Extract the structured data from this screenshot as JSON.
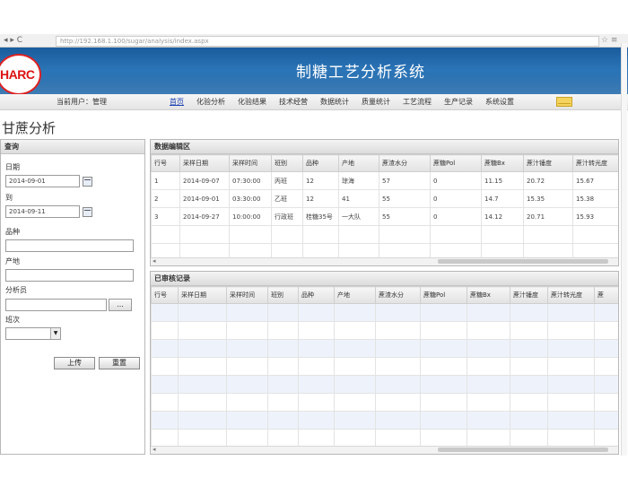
{
  "browser": {
    "nav": "◂ ▸ C",
    "address": "http://192.168.1.100/sugar/analysis/index.aspx",
    "star": "☆ ≡"
  },
  "header": {
    "logo_text": "HARC",
    "system_title": "制糖工艺分析系统"
  },
  "menubar": {
    "current_user": "当前用户：管理",
    "items": [
      "首页",
      "化验分析",
      "化验结果",
      "技术经营",
      "数据统计",
      "质量统计",
      "工艺流程",
      "生产记录",
      "系统设置"
    ],
    "active_index": 0
  },
  "page": {
    "title": "甘蔗分析"
  },
  "query": {
    "header": "查询",
    "date_label": "日期",
    "date_from": "2014-09-01",
    "to_label": "到",
    "date_to": "2014-09-11",
    "variety_label": "品种",
    "variety_value": "",
    "origin_label": "产地",
    "origin_value": "",
    "analyst_label": "分析员",
    "analyst_value": "",
    "browse_label": "...",
    "shift_label": "班次",
    "shift_value": "",
    "upload_label": "上传",
    "reset_label": "重置"
  },
  "upper_grid": {
    "header": "数据编辑区",
    "columns": [
      "行号",
      "采样日期",
      "采样时间",
      "班别",
      "品种",
      "产地",
      "蔗渣水分",
      "蔗糖Pol",
      "蔗糖Bx",
      "蔗汁锤度",
      "蔗汁转光度"
    ],
    "rows": [
      [
        "1",
        "2014-09-07",
        "07:30:00",
        "丙班",
        "12",
        "琼海",
        "57",
        "0",
        "11.15",
        "20.72",
        "15.67"
      ],
      [
        "2",
        "2014-09-01",
        "03:30:00",
        "乙班",
        "12",
        "41",
        "55",
        "0",
        "14.7",
        "15.35",
        "15.38"
      ],
      [
        "3",
        "2014-09-27",
        "10:00:00",
        "行政班",
        "桂糖35号",
        "一大队",
        "55",
        "0",
        "14.12",
        "20.71",
        "15.93"
      ]
    ]
  },
  "lower_grid": {
    "header": "已审核记录",
    "columns": [
      "行号",
      "采样日期",
      "采样时间",
      "班别",
      "品种",
      "产地",
      "蔗渣水分",
      "蔗糖Pol",
      "蔗糖Bx",
      "蔗汁锤度",
      "蔗汁转光度",
      "蔗"
    ]
  },
  "colors": {
    "banner": "#1f67ab",
    "accent_link": "#1c3fb0",
    "alt_row": "#eef3fb"
  },
  "icons": [
    "calendar-icon",
    "mail-icon",
    "chevron-down-icon",
    "scroll-left-icon"
  ]
}
